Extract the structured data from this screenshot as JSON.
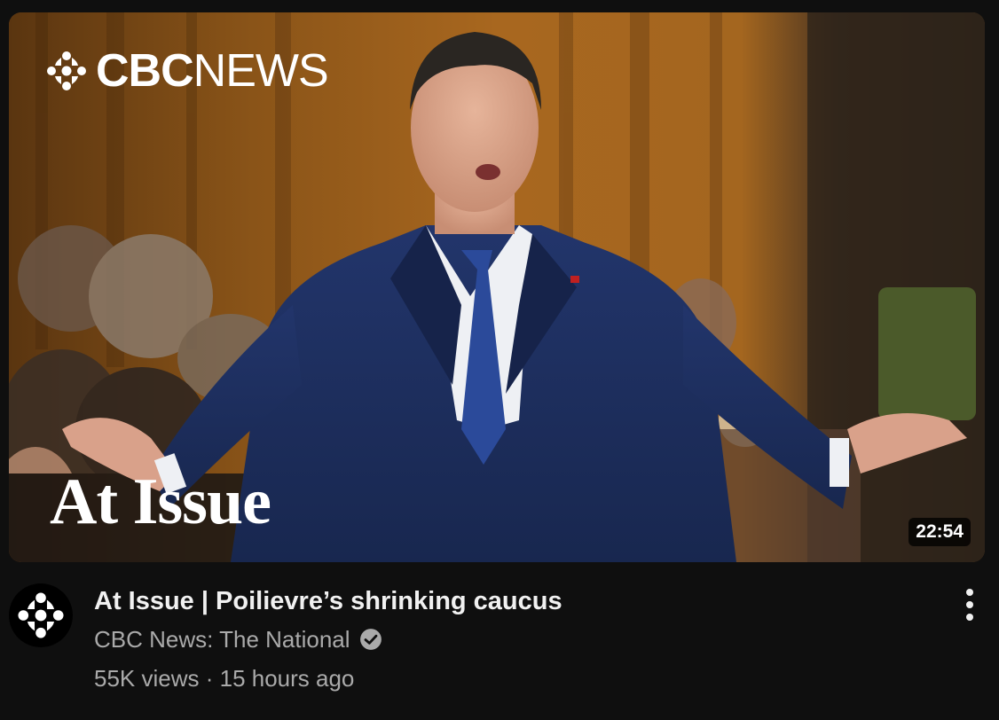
{
  "video": {
    "duration": "22:54",
    "title": "At Issue | Poilievre’s shrinking caucus",
    "channel": "CBC News: The National",
    "views": "55K views",
    "separator": " · ",
    "age": "15 hours ago"
  },
  "thumbnail": {
    "brand_bold": "CBC",
    "brand_light": "NEWS",
    "show_title": "At Issue"
  },
  "icons": {
    "channel_avatar": "cbc-gem-icon",
    "verified": "verified-check-icon",
    "more_actions": "more-vert-icon"
  },
  "colors": {
    "background": "#0f0f0f",
    "title": "#f1f1f1",
    "secondary_text": "#aaaaaa",
    "suit": "#1e2f5e"
  }
}
